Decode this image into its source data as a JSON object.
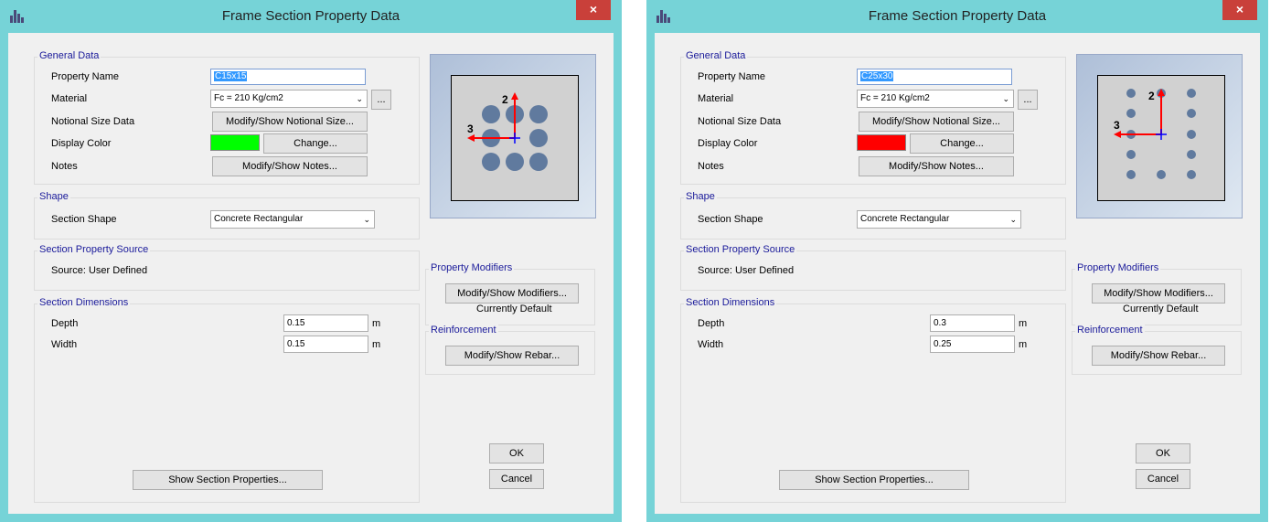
{
  "windows": [
    {
      "title": "Frame Section Property Data",
      "close_glyph": "×",
      "general": {
        "legend": "General Data",
        "property_name_label": "Property Name",
        "property_name_value": "C15x15",
        "material_label": "Material",
        "material_value": "Fc = 210 Kg/cm2",
        "ellipsis_label": "...",
        "notional_label": "Notional Size Data",
        "notional_button": "Modify/Show Notional Size...",
        "display_color_label": "Display Color",
        "display_color": "#00ff00",
        "change_button": "Change...",
        "notes_label": "Notes",
        "notes_button": "Modify/Show Notes..."
      },
      "shape": {
        "legend": "Shape",
        "section_shape_label": "Section Shape",
        "section_shape_value": "Concrete Rectangular"
      },
      "source": {
        "legend": "Section Property Source",
        "text": "Source:  User Defined"
      },
      "dimensions": {
        "legend": "Section Dimensions",
        "depth_label": "Depth",
        "depth_value": "0.15",
        "depth_unit": "m",
        "width_label": "Width",
        "width_value": "0.15",
        "width_unit": "m"
      },
      "modifiers": {
        "legend": "Property Modifiers",
        "button": "Modify/Show Modifiers...",
        "status": "Currently Default"
      },
      "reinforcement": {
        "legend": "Reinforcement",
        "button": "Modify/Show Rebar..."
      },
      "show_props_button": "Show Section Properties...",
      "ok_button": "OK",
      "cancel_button": "Cancel",
      "axis_2_label": "2",
      "axis_3_label": "3"
    },
    {
      "title": "Frame Section Property Data",
      "close_glyph": "×",
      "general": {
        "legend": "General Data",
        "property_name_label": "Property Name",
        "property_name_value": "C25x30",
        "material_label": "Material",
        "material_value": "Fc = 210 Kg/cm2",
        "ellipsis_label": "...",
        "notional_label": "Notional Size Data",
        "notional_button": "Modify/Show Notional Size...",
        "display_color_label": "Display Color",
        "display_color": "#ff0000",
        "change_button": "Change...",
        "notes_label": "Notes",
        "notes_button": "Modify/Show Notes..."
      },
      "shape": {
        "legend": "Shape",
        "section_shape_label": "Section Shape",
        "section_shape_value": "Concrete Rectangular"
      },
      "source": {
        "legend": "Section Property Source",
        "text": "Source:  User Defined"
      },
      "dimensions": {
        "legend": "Section Dimensions",
        "depth_label": "Depth",
        "depth_value": "0.3",
        "depth_unit": "m",
        "width_label": "Width",
        "width_value": "0.25",
        "width_unit": "m"
      },
      "modifiers": {
        "legend": "Property Modifiers",
        "button": "Modify/Show Modifiers...",
        "status": "Currently Default"
      },
      "reinforcement": {
        "legend": "Reinforcement",
        "button": "Modify/Show Rebar..."
      },
      "show_props_button": "Show Section Properties...",
      "ok_button": "OK",
      "cancel_button": "Cancel",
      "axis_2_label": "2",
      "axis_3_label": "3"
    }
  ],
  "colors": {
    "titlebar": "#76d3d7",
    "close_button": "#c9403a",
    "group_title": "#1a1a9a",
    "rebar": "#607a9e",
    "axis_2_arrow": "#ff0000",
    "axis_3_arrow": "#ff0000",
    "origin_cross": "#0000ff"
  },
  "icons": {
    "app": "etabs-app-icon",
    "close": "close-icon",
    "dropdown": "chevron-down-icon"
  }
}
